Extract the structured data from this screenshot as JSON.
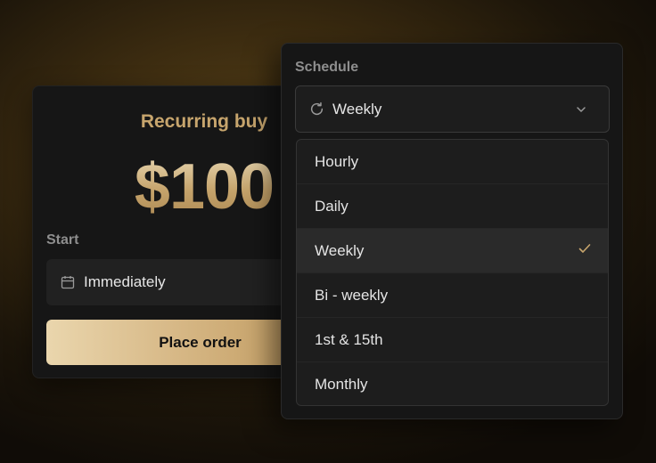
{
  "order_card": {
    "title": "Recurring buy",
    "amount": "$100",
    "start_label": "Start",
    "start_value": "Immediately",
    "place_order_label": "Place order"
  },
  "schedule": {
    "label": "Schedule",
    "selected_value": "Weekly",
    "options": [
      {
        "label": "Hourly",
        "selected": false
      },
      {
        "label": "Daily",
        "selected": false
      },
      {
        "label": "Weekly",
        "selected": true
      },
      {
        "label": "Bi - weekly",
        "selected": false
      },
      {
        "label": "1st & 15th",
        "selected": false
      },
      {
        "label": "Monthly",
        "selected": false
      }
    ]
  },
  "icons": {
    "start": "calendar-icon",
    "select": "refresh-icon",
    "dropdown": "chevron-down-icon",
    "selected_marker": "checkmark-icon"
  },
  "colors": {
    "accent_gold": "#c7a56d",
    "card_bg": "#161616",
    "field_bg": "#212121",
    "selected_row_bg": "#2a2a2a"
  }
}
